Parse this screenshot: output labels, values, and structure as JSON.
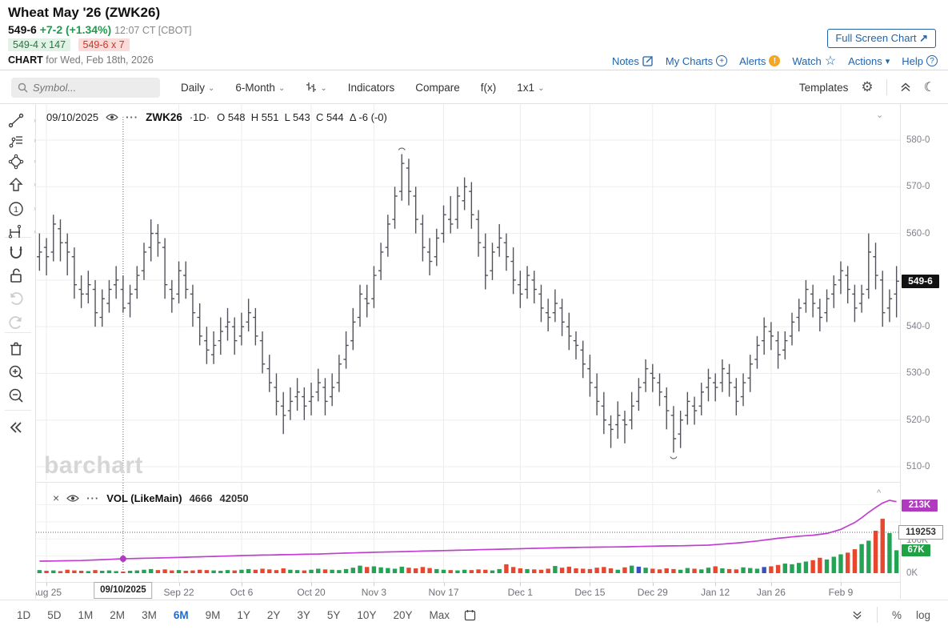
{
  "header": {
    "title": "Wheat May '26 (ZWK26)",
    "last_price": "549-6",
    "change": "+7-2 (+1.34%)",
    "quote_time": "12:07 CT [CBOT]",
    "bid": "549-4 x 147",
    "ask": "549-6 x 7",
    "chart_label": "CHART",
    "chart_for": " for Wed, Feb 18th, 2026",
    "full_screen_label": "Full Screen Chart",
    "full_screen_arrow": "↗",
    "links": [
      {
        "label": "Notes",
        "icon": "notes-icon"
      },
      {
        "label": "My Charts",
        "icon": "add-circle-icon"
      },
      {
        "label": "Alerts",
        "icon": "alert-badge-icon"
      },
      {
        "label": "Watch",
        "icon": "star-icon"
      },
      {
        "label": "Actions",
        "icon": "caret-down-icon"
      },
      {
        "label": "Help",
        "icon": "question-circle-icon"
      }
    ]
  },
  "toolbar": {
    "symbol_placeholder": "Symbol...",
    "period": "Daily",
    "range": "6-Month",
    "indicators": "Indicators",
    "compare": "Compare",
    "fx": "f(x)",
    "grid": "1x1",
    "templates": "Templates"
  },
  "rail_tools": [
    "trendline",
    "annotations",
    "shapes",
    "arrow",
    "number-note",
    "measure",
    "magnet",
    "lock-open",
    "undo",
    "redo",
    "trash",
    "zoom-in",
    "zoom-out",
    "collapse-rail"
  ],
  "legend": {
    "crosshair_date": "09/10/2025",
    "symbol": "ZWK26",
    "interval": "·1D·",
    "ohlc_text": "O 548  H 551  L 543  C 544  Δ -6 (-0)"
  },
  "volume_legend": {
    "close": "×",
    "name": "VOL (LikeMain)",
    "value1": "4666",
    "value2": "42050"
  },
  "watermark": "barchart",
  "y_axis": {
    "labels": [
      [
        "580-0",
        580
      ],
      [
        "570-0",
        570
      ],
      [
        "560-0",
        560
      ],
      [
        "540-0",
        540
      ],
      [
        "530-0",
        530
      ],
      [
        "520-0",
        520
      ],
      [
        "510-0",
        510
      ]
    ],
    "current_badge": "549-6",
    "current_price": 549.75
  },
  "volume_axis": {
    "badge_top": "213K",
    "badge_top_value": 213,
    "crosshair_label": "119253",
    "crosshair_value": 119.253,
    "badge_current": "67K",
    "badge_current_value": 67,
    "zero_label": "0K",
    "hidden_label": "100K",
    "hidden_value": 100
  },
  "x_axis": {
    "ticks": [
      {
        "label": "Aug 25",
        "i": 1
      },
      {
        "label": "Sep 22",
        "i": 20
      },
      {
        "label": "Oct 6",
        "i": 29
      },
      {
        "label": "Oct 20",
        "i": 39
      },
      {
        "label": "Nov 3",
        "i": 48
      },
      {
        "label": "Nov 17",
        "i": 58
      },
      {
        "label": "Dec 1",
        "i": 69
      },
      {
        "label": "Dec 15",
        "i": 79
      },
      {
        "label": "Dec 29",
        "i": 88
      },
      {
        "label": "Jan 12",
        "i": 97
      },
      {
        "label": "Jan 26",
        "i": 105
      },
      {
        "label": "Feb 9",
        "i": 115
      }
    ],
    "crosshair_tooltip": "09/10/2025",
    "crosshair_index": 12
  },
  "ranges": [
    "1D",
    "5D",
    "1M",
    "2M",
    "3M",
    "6M",
    "9M",
    "1Y",
    "2Y",
    "3Y",
    "5Y",
    "10Y",
    "20Y",
    "Max"
  ],
  "active_range": "6M",
  "footer_right": {
    "percent": "%",
    "log": "log"
  },
  "colors": {
    "link_blue": "#2264aa",
    "active_blue": "#1f6cd5",
    "up_green": "#23a455",
    "down_red": "#e8472f",
    "unchanged_blue": "#3b4fc4",
    "oi_magenta": "#c13fd0",
    "oi_badge": "#b03bbf",
    "vol_badge_green": "#1fa144",
    "bar_stroke": "#52525b",
    "grid": "#ededed",
    "crosshair": "#666"
  },
  "chart_data": {
    "type": "ohlc-bar",
    "title": "ZWK26 Daily OHLC with volume and open interest",
    "price_ylim": [
      507,
      588
    ],
    "price_gridlines": [
      580,
      570,
      560,
      550,
      540,
      530,
      520,
      510
    ],
    "high_marker_index": 52,
    "low_marker_index": 91,
    "bars": [
      [
        555,
        560,
        552,
        556
      ],
      [
        557,
        559,
        551,
        555
      ],
      [
        556,
        564,
        554,
        562
      ],
      [
        561,
        563,
        554,
        558
      ],
      [
        558,
        560,
        551,
        556
      ],
      [
        555,
        557,
        546,
        549
      ],
      [
        548,
        551,
        544,
        547
      ],
      [
        547,
        552,
        545,
        549
      ],
      [
        548,
        550,
        540,
        543
      ],
      [
        542,
        548,
        540,
        546
      ],
      [
        545,
        550,
        543,
        548
      ],
      [
        549,
        553,
        546,
        550
      ],
      [
        548,
        551,
        543,
        544
      ],
      [
        545,
        549,
        542,
        547
      ],
      [
        548,
        553,
        546,
        551
      ],
      [
        552,
        558,
        550,
        556
      ],
      [
        557,
        563,
        554,
        560
      ],
      [
        560,
        562,
        555,
        558
      ],
      [
        557,
        559,
        546,
        549
      ],
      [
        548,
        550,
        543,
        546
      ],
      [
        547,
        554,
        545,
        552
      ],
      [
        551,
        554,
        546,
        548
      ],
      [
        547,
        549,
        540,
        543
      ],
      [
        542,
        545,
        536,
        538
      ],
      [
        537,
        540,
        532,
        535
      ],
      [
        534,
        539,
        532,
        536
      ],
      [
        537,
        542,
        534,
        539
      ],
      [
        540,
        544,
        537,
        541
      ],
      [
        540,
        542,
        534,
        537
      ],
      [
        538,
        543,
        536,
        540
      ],
      [
        541,
        546,
        539,
        543
      ],
      [
        542,
        544,
        536,
        538
      ],
      [
        537,
        539,
        530,
        532
      ],
      [
        531,
        534,
        526,
        528
      ],
      [
        527,
        530,
        521,
        524
      ],
      [
        523,
        526,
        517,
        521
      ],
      [
        522,
        527,
        520,
        524
      ],
      [
        525,
        529,
        522,
        526
      ],
      [
        525,
        527,
        520,
        523
      ],
      [
        524,
        528,
        521,
        525
      ],
      [
        526,
        531,
        524,
        528
      ],
      [
        527,
        529,
        521,
        524
      ],
      [
        525,
        530,
        523,
        527
      ],
      [
        528,
        534,
        526,
        532
      ],
      [
        533,
        539,
        531,
        536
      ],
      [
        537,
        544,
        535,
        541
      ],
      [
        542,
        549,
        540,
        547
      ],
      [
        546,
        549,
        542,
        545
      ],
      [
        546,
        553,
        544,
        551
      ],
      [
        552,
        558,
        550,
        556
      ],
      [
        557,
        564,
        555,
        562
      ],
      [
        563,
        570,
        561,
        568
      ],
      [
        569,
        577,
        567,
        575
      ],
      [
        574,
        576,
        566,
        569
      ],
      [
        568,
        570,
        560,
        563
      ],
      [
        562,
        564,
        554,
        557
      ],
      [
        556,
        559,
        551,
        554
      ],
      [
        555,
        561,
        553,
        559
      ],
      [
        560,
        566,
        558,
        564
      ],
      [
        563,
        568,
        560,
        562
      ],
      [
        563,
        570,
        561,
        568
      ],
      [
        567,
        572,
        565,
        570
      ],
      [
        569,
        571,
        561,
        564
      ],
      [
        563,
        565,
        555,
        558
      ],
      [
        557,
        560,
        548,
        551
      ],
      [
        552,
        558,
        550,
        556
      ],
      [
        557,
        562,
        555,
        559
      ],
      [
        558,
        560,
        552,
        555
      ],
      [
        554,
        557,
        547,
        550
      ],
      [
        549,
        552,
        544,
        547
      ],
      [
        548,
        553,
        546,
        551
      ],
      [
        550,
        552,
        545,
        548
      ],
      [
        547,
        549,
        541,
        544
      ],
      [
        543,
        546,
        539,
        542
      ],
      [
        543,
        548,
        541,
        545
      ],
      [
        544,
        546,
        538,
        541
      ],
      [
        540,
        543,
        535,
        538
      ],
      [
        537,
        539,
        533,
        536
      ],
      [
        535,
        537,
        529,
        532
      ],
      [
        531,
        534,
        525,
        528
      ],
      [
        527,
        530,
        521,
        524
      ],
      [
        523,
        526,
        517,
        520
      ],
      [
        519,
        521,
        514,
        518
      ],
      [
        519,
        524,
        516,
        521
      ],
      [
        520,
        522,
        515,
        519
      ],
      [
        520,
        526,
        518,
        523
      ],
      [
        524,
        529,
        522,
        527
      ],
      [
        528,
        533,
        526,
        531
      ],
      [
        530,
        532,
        526,
        529
      ],
      [
        528,
        530,
        523,
        526
      ],
      [
        525,
        527,
        518,
        522
      ],
      [
        521,
        523,
        513,
        516
      ],
      [
        517,
        522,
        514,
        520
      ],
      [
        521,
        526,
        519,
        524
      ],
      [
        523,
        525,
        519,
        522
      ],
      [
        523,
        528,
        521,
        526
      ],
      [
        527,
        531,
        524,
        529
      ],
      [
        528,
        530,
        524,
        527
      ],
      [
        528,
        533,
        526,
        531
      ],
      [
        530,
        532,
        525,
        528
      ],
      [
        527,
        529,
        521,
        524
      ],
      [
        525,
        530,
        523,
        528
      ],
      [
        529,
        534,
        526,
        532
      ],
      [
        533,
        538,
        531,
        536
      ],
      [
        537,
        542,
        534,
        540
      ],
      [
        539,
        541,
        535,
        538
      ],
      [
        537,
        539,
        531,
        534
      ],
      [
        535,
        539,
        533,
        537
      ],
      [
        538,
        543,
        536,
        541
      ],
      [
        542,
        546,
        539,
        544
      ],
      [
        545,
        550,
        543,
        548
      ],
      [
        547,
        549,
        542,
        545
      ],
      [
        544,
        546,
        539,
        542
      ],
      [
        543,
        548,
        541,
        546
      ],
      [
        547,
        551,
        544,
        549
      ],
      [
        550,
        554,
        547,
        552
      ],
      [
        551,
        553,
        545,
        548
      ],
      [
        547,
        549,
        541,
        544
      ],
      [
        545,
        549,
        543,
        547
      ],
      [
        548,
        560,
        546,
        556
      ],
      [
        555,
        558,
        548,
        551
      ],
      [
        550,
        552,
        540,
        543
      ],
      [
        544,
        548,
        541,
        546
      ],
      [
        547,
        553,
        542,
        549.75
      ]
    ],
    "volume": {
      "ylim_k": [
        0,
        265
      ],
      "gridlines_k": [
        50,
        100,
        150,
        200
      ],
      "blue_indices": [
        86,
        104
      ],
      "values_k": [
        9,
        7,
        8,
        6,
        10,
        8,
        7,
        6,
        9,
        7,
        8,
        6,
        4.666,
        7,
        8,
        10,
        12,
        9,
        11,
        8,
        9,
        7,
        8,
        10,
        9,
        8,
        7,
        9,
        8,
        10,
        12,
        10,
        13,
        11,
        9,
        14,
        10,
        9,
        8,
        10,
        13,
        11,
        10,
        9,
        12,
        16,
        22,
        18,
        20,
        17,
        15,
        13,
        19,
        16,
        14,
        18,
        15,
        12,
        10,
        9,
        8,
        10,
        9,
        11,
        10,
        8,
        12,
        26,
        18,
        14,
        12,
        11,
        10,
        13,
        21,
        16,
        19,
        14,
        13,
        12,
        16,
        18,
        14,
        10,
        17,
        22,
        19,
        16,
        13,
        11,
        14,
        12,
        10,
        15,
        13,
        11,
        16,
        20,
        14,
        12,
        11,
        17,
        15,
        13,
        18,
        20,
        24,
        28,
        26,
        30,
        34,
        38,
        45,
        40,
        48,
        55,
        60,
        70,
        85,
        95,
        124,
        159,
        117,
        67
      ]
    },
    "open_interest_anchors_k": [
      [
        0,
        35
      ],
      [
        6,
        37
      ],
      [
        12,
        42.05
      ],
      [
        20,
        46
      ],
      [
        30,
        52
      ],
      [
        40,
        56
      ],
      [
        46,
        60
      ],
      [
        52,
        63
      ],
      [
        58,
        66
      ],
      [
        64,
        69
      ],
      [
        70,
        72
      ],
      [
        76,
        75
      ],
      [
        80,
        76
      ],
      [
        84,
        77
      ],
      [
        88,
        79
      ],
      [
        92,
        80
      ],
      [
        96,
        82
      ],
      [
        100,
        88
      ],
      [
        103,
        94
      ],
      [
        106,
        102
      ],
      [
        109,
        108
      ],
      [
        111,
        111
      ],
      [
        113,
        116
      ],
      [
        115,
        128
      ],
      [
        117,
        148
      ],
      [
        118,
        162
      ],
      [
        119,
        178
      ],
      [
        120,
        192
      ],
      [
        121,
        205
      ],
      [
        122,
        213
      ],
      [
        123,
        209
      ]
    ]
  }
}
